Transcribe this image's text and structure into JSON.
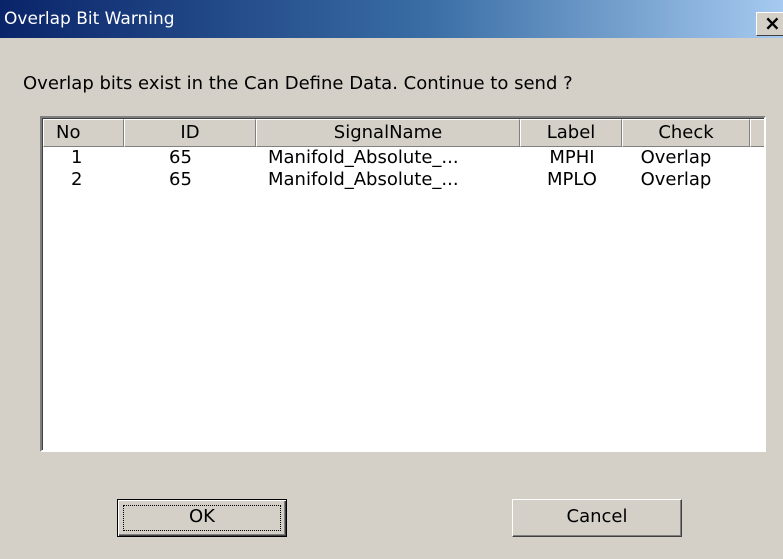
{
  "window": {
    "title": "Overlap Bit Warning",
    "close_glyph": "×",
    "close_icon": "close-icon"
  },
  "message": "Overlap bits exist in the Can Define Data.  Continue to send ?",
  "table": {
    "columns": [
      "No",
      "ID",
      "SignalName",
      "Label",
      "Check"
    ],
    "rows": [
      {
        "no": "1",
        "id": "65",
        "signal_name": "Manifold_Absolute_...",
        "label": "MPHI",
        "check": "Overlap"
      },
      {
        "no": "2",
        "id": "65",
        "signal_name": "Manifold_Absolute_...",
        "label": "MPLO",
        "check": "Overlap"
      }
    ]
  },
  "buttons": {
    "ok_label": "OK",
    "cancel_label": "Cancel"
  },
  "colors": {
    "face": "#d4d0c8",
    "title_gradient_start": "#0a246a",
    "title_gradient_end": "#a6caf0"
  }
}
